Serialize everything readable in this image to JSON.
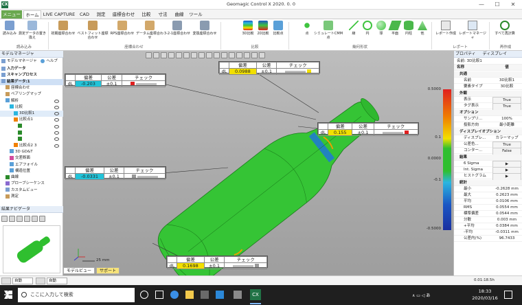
{
  "window": {
    "title": "Geomagic Control X 2020. 0. 0",
    "app_icon": "CX",
    "controls": [
      "—",
      "☐",
      "✕"
    ]
  },
  "tabs": [
    "メニュー",
    "ホーム",
    "LIVE CAPTURE",
    "CAD",
    "測定",
    "座標合わせ",
    "比較",
    "寸法",
    "曲線",
    "ツール"
  ],
  "ribbon": {
    "buttons": [
      "読み込み",
      "測定データの置き換え",
      "初期座標合わせ",
      "ベストフィット座標合わせ",
      "RPS座標合わせ",
      "データム座標合わせ",
      "3-2-1座標合わせ",
      "変換座標合わせ",
      "3D比較",
      "2D比較",
      "比較点",
      "点",
      "シミュレートCMM点",
      "線",
      "円",
      "球",
      "平面",
      "円柱",
      "他",
      "レポート作成",
      "レポートマネージャ",
      "すべて再計算"
    ],
    "groups": [
      "読み込み",
      "座標合わせ",
      "比較",
      "幾何形状",
      "レポート",
      "再作成"
    ]
  },
  "left_panel": {
    "tabs": [
      "モデルマネージャ",
      "ヘルプ"
    ],
    "header": "モデルマネージャ",
    "tree": [
      "入力データ",
      "スキャンプロセス",
      "結果データ:1",
      "座標合わせ",
      "ペアリングマップ",
      "解析",
      "比較",
      "3D比較1",
      "比較点1",
      "",
      "",
      "",
      "比較点2",
      "3D GD&T",
      "交差断面",
      "エアフォイル",
      "構造位置",
      "曲線",
      "プローブシーケンス",
      "カスタムビュー",
      "測定"
    ],
    "tree_counts": [
      "",
      "",
      "",
      "",
      "",
      "",
      "",
      "",
      "",
      "",
      "",
      "",
      "3",
      "",
      "",
      "",
      "",
      "",
      "",
      "",
      ""
    ],
    "navigator": "結果ナビゲータ"
  },
  "annotations": [
    {
      "label": "dL",
      "value": "-0.203",
      "tol": "±0.1",
      "color": "#22c3d8",
      "check": "red"
    },
    {
      "label": "dL",
      "value": "0.0988",
      "tol": "±0.1",
      "color": "#f2e000",
      "check": "yellow"
    },
    {
      "label": "dL",
      "value": "0.155",
      "tol": "±0.1",
      "color": "#f2e000",
      "check": "red"
    },
    {
      "label": "dL",
      "value": "-0.0331",
      "tol": "±0.1",
      "color": "#22c3d8",
      "check": "gray"
    },
    {
      "label": "dL",
      "value": "0.1698",
      "tol": "±0.1",
      "color": "#f2e000",
      "check": "gray"
    }
  ],
  "annotation_headers": {
    "dev": "偏差",
    "tol": "公差",
    "check": "チェック"
  },
  "colorbar": {
    "labels": [
      "0.5000",
      "0.1",
      "0.0000",
      "-0.1",
      "-0.5000"
    ],
    "extra": [
      "—",
      "—",
      "—",
      "—"
    ]
  },
  "scale": "25 mm",
  "viewport_tabs": [
    "モデルビュー",
    "サポート"
  ],
  "right_panel": {
    "tabs": [
      "プロパティ",
      "ディスプレイ"
    ],
    "title": "名前: 3D比較1",
    "header": {
      "k": "名称",
      "v": "値"
    },
    "sections": {
      "common": "共通",
      "appearance": "外観",
      "option": "オプション",
      "display_option": "ディスプレイオプション",
      "result": "結果",
      "stats": "統計"
    },
    "rows": {
      "name": {
        "k": "名前",
        "v": "3D比較1"
      },
      "feature_type": {
        "k": "要素タイプ",
        "v": "3D比較"
      },
      "display": {
        "k": "表示",
        "v": "True"
      },
      "tag_display": {
        "k": "タグ表示",
        "v": "True"
      },
      "sampling": {
        "k": "サンプリ...",
        "v": "100%"
      },
      "direction": {
        "k": "投影方向",
        "v": "最小距離"
      },
      "display2": {
        "k": "ディスプレ...",
        "v": "カラーマップ"
      },
      "tol_color": {
        "k": "公差色...",
        "v": "True"
      },
      "contour": {
        "k": "コンター...",
        "v": "False"
      },
      "six_sigma": {
        "k": "6 Sigma",
        "v": "▶"
      },
      "int_sigma": {
        "k": "Int. Sigma",
        "v": "▶"
      },
      "histogram": {
        "k": "ヒストグラム",
        "v": "▶"
      },
      "min": {
        "k": "最小",
        "v": "-0.2628 mm"
      },
      "max": {
        "k": "最大",
        "v": "0.2623 mm"
      },
      "avg": {
        "k": "平均",
        "v": "0.0106 mm"
      },
      "rms": {
        "k": "RMS",
        "v": "0.0554 mm"
      },
      "stddev": {
        "k": "標準偏差",
        "v": "0.0544 mm"
      },
      "variance": {
        "k": "分散",
        "v": "0.003 mm"
      },
      "pos_avg": {
        "k": "+平均",
        "v": "0.0384 mm"
      },
      "neg_avg": {
        "k": "-平均",
        "v": "-0.0311 mm"
      },
      "in_tol": {
        "k": "公差内(%)",
        "v": "96.7433"
      }
    }
  },
  "bottom": {
    "combo1": "自動",
    "combo2": "自動",
    "time": "0.01:18.5h",
    "status": ""
  },
  "taskbar": {
    "search": "ここに入力して検索",
    "clock": "18:33",
    "date": "2020/03/16"
  }
}
